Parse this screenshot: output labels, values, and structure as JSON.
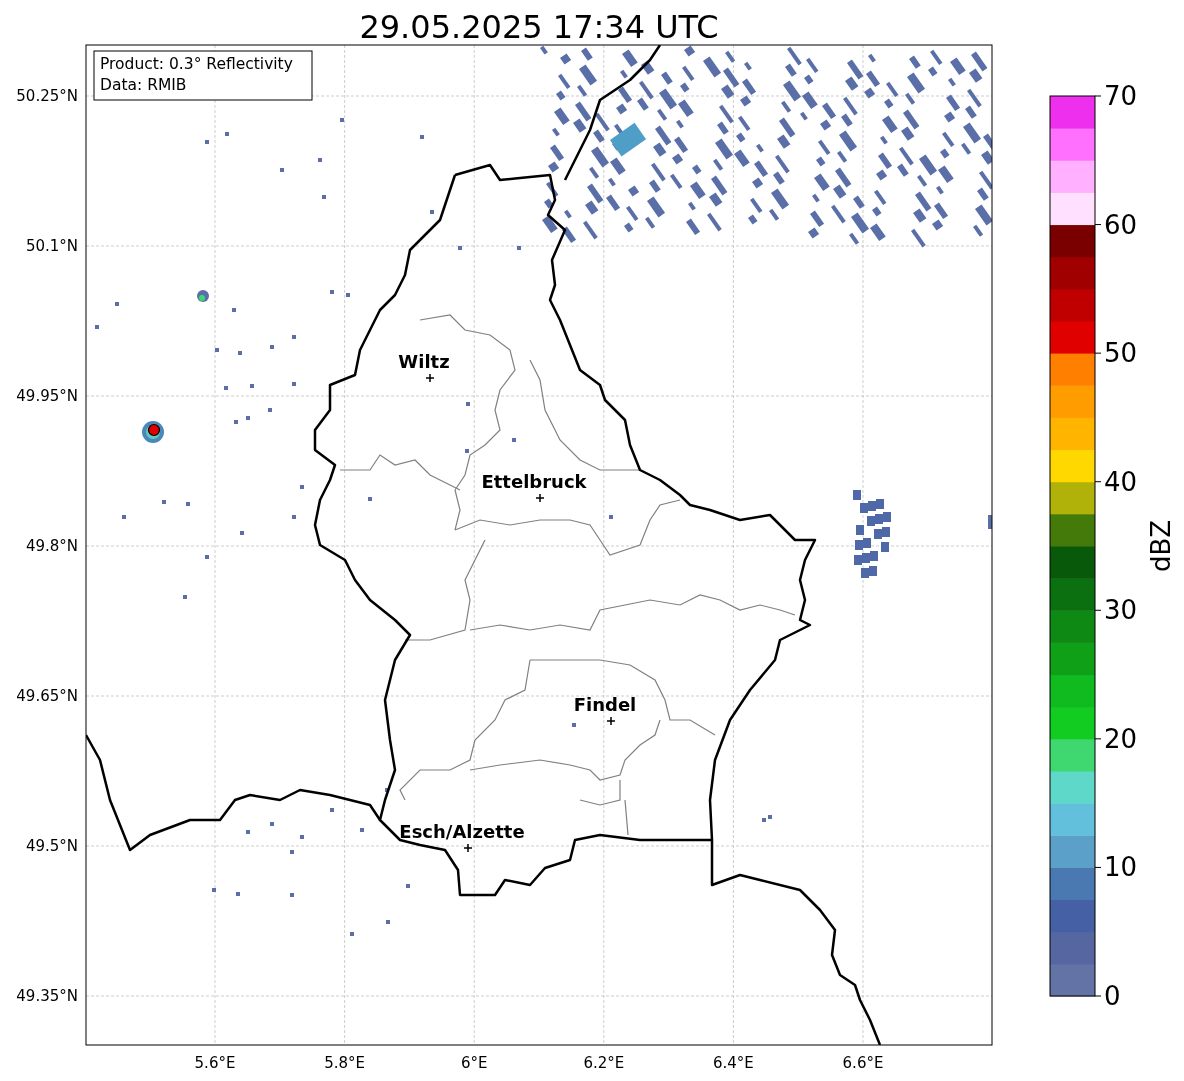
{
  "title": "29.05.2025 17:34 UTC",
  "legend": {
    "lines": [
      "Product: 0.3° Reflectivity",
      "Data: RMIB"
    ]
  },
  "map": {
    "yticks": [
      "50.25°N",
      "50.1°N",
      "49.95°N",
      "49.8°N",
      "49.65°N",
      "49.5°N",
      "49.35°N"
    ],
    "xticks": [
      "5.6°E",
      "5.8°E",
      "6°E",
      "6.2°E",
      "6.4°E",
      "6.6°E"
    ],
    "cities": [
      {
        "name": "Wiltz"
      },
      {
        "name": "Ettelbruck"
      },
      {
        "name": "Findel"
      },
      {
        "name": "Esch/Alzette"
      }
    ]
  },
  "colorbar": {
    "label": "dBZ",
    "ticks": [
      "70",
      "60",
      "50",
      "40",
      "30",
      "20",
      "10",
      "0"
    ],
    "segments": [
      {
        "color": "#6373a6"
      },
      {
        "color": "#5566a0"
      },
      {
        "color": "#4560a5"
      },
      {
        "color": "#4a78b0"
      },
      {
        "color": "#5aa0c8"
      },
      {
        "color": "#63c0dc"
      },
      {
        "color": "#5ed8c8"
      },
      {
        "color": "#3fd870"
      },
      {
        "color": "#12cc22"
      },
      {
        "color": "#10bb20"
      },
      {
        "color": "#10a018"
      },
      {
        "color": "#0e8a14"
      },
      {
        "color": "#0b7010"
      },
      {
        "color": "#085a0a"
      },
      {
        "color": "#447a0a"
      },
      {
        "color": "#b0b20a"
      },
      {
        "color": "#ffd800"
      },
      {
        "color": "#ffb400"
      },
      {
        "color": "#ff9c00"
      },
      {
        "color": "#ff7f00"
      },
      {
        "color": "#e00000"
      },
      {
        "color": "#c00000"
      },
      {
        "color": "#a00000"
      },
      {
        "color": "#7a0000"
      },
      {
        "color": "#ffe0ff"
      },
      {
        "color": "#ffb0ff"
      },
      {
        "color": "#ff70ff"
      },
      {
        "color": "#ee30ee"
      }
    ]
  }
}
